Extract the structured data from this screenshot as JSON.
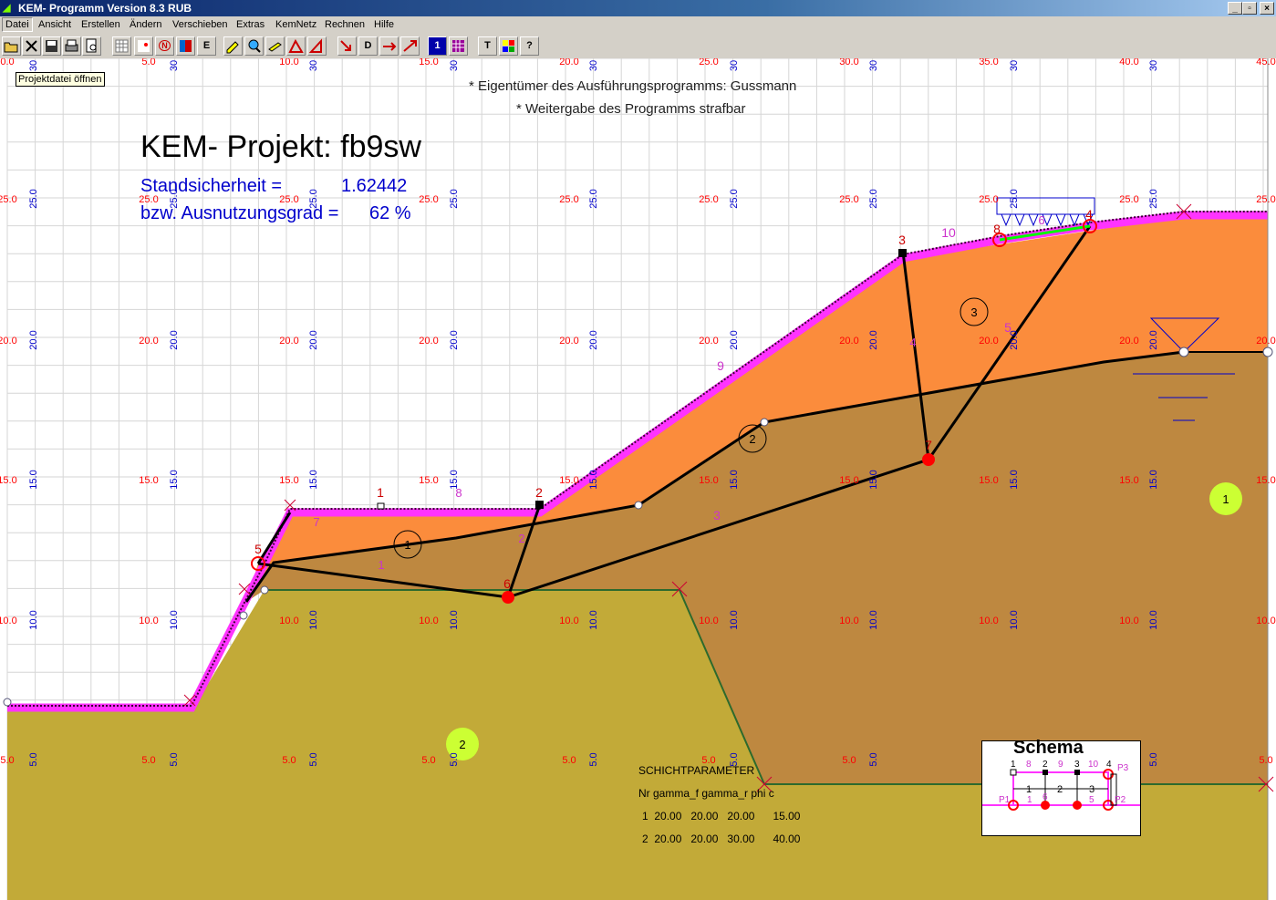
{
  "window": {
    "title": "KEM- Programm Version 8.3 RUB",
    "btn_min": "_",
    "btn_max": "▫",
    "btn_close": "×"
  },
  "menu": [
    "Datei",
    "Ansicht",
    "Erstellen",
    "Ändern",
    "Verschieben",
    "Extras",
    "KemNetz",
    "Rechnen",
    "Hilfe"
  ],
  "toolbar": {
    "icons": [
      "open-icon",
      "close-icon",
      "save-icon",
      "print-icon",
      "preview-icon",
      "grid-icon",
      "point-icon",
      "n-icon",
      "layer-icon",
      "e-icon",
      "edit-icon",
      "zoom-icon",
      "pencil-icon",
      "triangle-icon",
      "triangle2-icon",
      "arrow-icon",
      "d-icon",
      "load-icon",
      "load2-icon",
      "one-icon",
      "matrix-icon",
      "text-icon",
      "palette-icon",
      "help-icon"
    ],
    "e_label": "E",
    "n_label": "N",
    "d_label": "D",
    "one_label": "1",
    "text_label": "T"
  },
  "tooltip": "Projektdatei öffnen",
  "copyright": [
    "* Eigentümer des Ausführungsprogramms: Gussmann",
    "* Weitergabe des Programms strafbar"
  ],
  "project_title": "KEM- Projekt: fb9sw",
  "results": {
    "l1_label": "Standsicherheit =",
    "l1_value": "1.62442",
    "l2_label": "bzw. Ausnutzungsgrad =",
    "l2_value": "62 %"
  },
  "colors": {
    "soil1": "#fb8c3c",
    "soil2": "#c2aa38",
    "soil_overlap": "#be8840",
    "surface": "#ff33ff",
    "grid": "#d6d6d6",
    "red_label": "#ff0000",
    "blue_label": "#0000cc",
    "magenta_label": "#cc33cc"
  },
  "grid": {
    "red_x_labels": [
      "0.0",
      "5.0",
      "10.0",
      "15.0",
      "20.0",
      "25.0",
      "30.0",
      "35.0",
      "40.0",
      "45.0"
    ],
    "red_y_labels": [
      "25.0",
      "20.0",
      "15.0",
      "10.0",
      "5.0"
    ],
    "blue_x_labels": [
      "30",
      "30",
      "30",
      "30",
      "30",
      "30",
      "30",
      "30",
      "30"
    ],
    "blue_y_labels": [
      "25.0",
      "20.0",
      "15.0",
      "10.0",
      "5.0"
    ]
  },
  "nodes_black": [
    "1",
    "2",
    "3",
    "4"
  ],
  "nodes_red": [
    "5",
    "6",
    "7",
    "8",
    "9"
  ],
  "edges_magenta": [
    "1",
    "2",
    "3",
    "4",
    "5",
    "6",
    "7",
    "8",
    "9",
    "10"
  ],
  "bodies": [
    "1",
    "2",
    "3"
  ],
  "layers": [
    "1",
    "2"
  ],
  "schicht": {
    "title": "SCHICHTPARAMETER",
    "header": "Nr gamma_f gamma_r phi c",
    "rows": [
      "1  20.00   20.00   20.00      15.00",
      "2  20.00   20.00   30.00      40.00"
    ]
  },
  "schema": {
    "title": "Schema",
    "labels": [
      "1",
      "8",
      "2",
      "9",
      "3",
      "10",
      "4",
      "P3",
      "1",
      "6",
      "2",
      "3",
      "P1",
      "1",
      "5",
      "P2"
    ]
  }
}
